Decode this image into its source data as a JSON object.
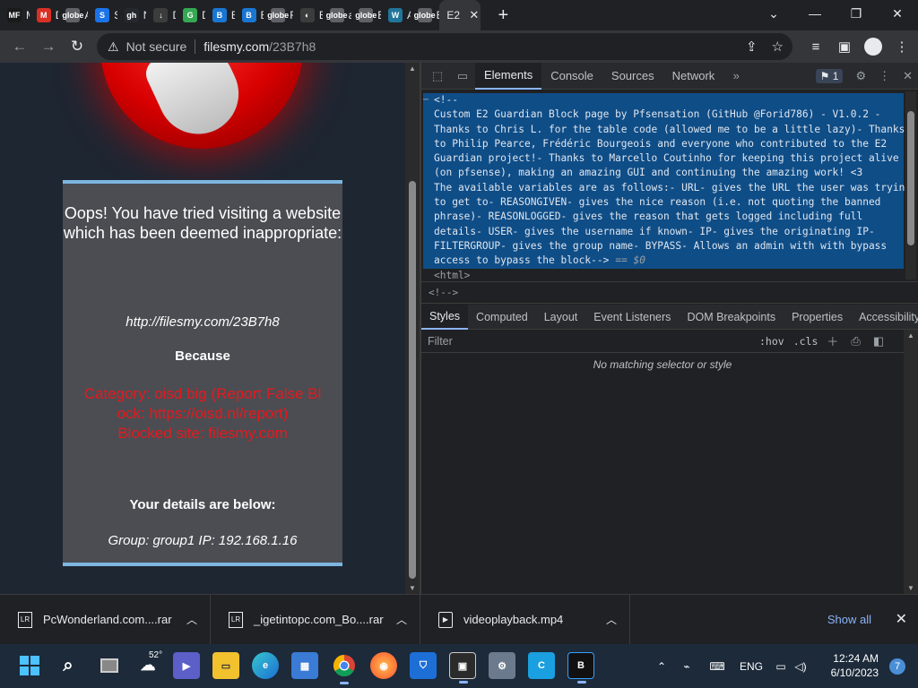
{
  "browser": {
    "tabs": [
      {
        "label": "M",
        "favicon": "MF",
        "color": "#1a1a1a"
      },
      {
        "label": "D",
        "favicon": "M",
        "color": "#d93025"
      },
      {
        "label": "A",
        "favicon": "globe",
        "color": "#5f6368"
      },
      {
        "label": "S",
        "favicon": "S",
        "color": "#1a73e8"
      },
      {
        "label": "N",
        "favicon": "gh",
        "color": "#24292f"
      },
      {
        "label": "D",
        "favicon": "↓",
        "color": "#3c3c3c"
      },
      {
        "label": "D",
        "favicon": "G",
        "color": "#34a853"
      },
      {
        "label": "B",
        "favicon": "B",
        "color": "#1976d2"
      },
      {
        "label": "B",
        "favicon": "B",
        "color": "#1976d2"
      },
      {
        "label": "F",
        "favicon": "globe",
        "color": "#5f6368"
      },
      {
        "label": "B",
        "favicon": "◐",
        "color": "#3c3c3c"
      },
      {
        "label": "a",
        "favicon": "globe",
        "color": "#5f6368"
      },
      {
        "label": "E",
        "favicon": "globe",
        "color": "#5f6368"
      },
      {
        "label": "A",
        "favicon": "W",
        "color": "#21759b"
      },
      {
        "label": "E",
        "favicon": "globe",
        "color": "#5f6368"
      }
    ],
    "active_tab": {
      "label": "E2",
      "close": "✕"
    },
    "new_tab": "+",
    "window_controls": {
      "list": "⌄",
      "minimize": "—",
      "maximize": "❐",
      "close": "✕"
    },
    "toolbar": {
      "back": "←",
      "forward": "→",
      "reload": "↻",
      "security_icon": "⚠",
      "security_text": "Not secure",
      "host": "filesmy.com",
      "path": "/23B7h8",
      "share": "⇪",
      "bookmark": "☆",
      "media": "≡",
      "sidepanel": "▣",
      "profile": "●",
      "menu": "⋮"
    }
  },
  "page": {
    "title": "Oops! You have tried visiting a website which has been deemed inappropriate:",
    "url": "http://filesmy.com/23B7h8",
    "because": "Because",
    "reason_lines": [
      "Category: oisd big (Report False Bl",
      "ock: https://oisd.nl/report)",
      "Blocked site: filesmy.com"
    ],
    "details_heading": "Your details are below:",
    "group_line": "Group: group1   IP: 192.168.1.16"
  },
  "devtools": {
    "tabs": [
      "Elements",
      "Console",
      "Sources",
      "Network"
    ],
    "active_tab": "Elements",
    "more": "»",
    "issues_count": "1",
    "dom_lines": [
      "<!--",
      "Custom E2 Guardian Block page by Pfsensation (GitHub @Forid786) - V1.0.2 -",
      "Thanks to Chris L. for the table code (allowed me to be a little lazy)- Thanks",
      "to Philip Pearce, Frédéric Bourgeois and everyone who contributed to the E2",
      "Guardian project!- Thanks to Marcello Coutinho for keeping this project alive",
      "(on pfsense), making an amazing GUI and continuing the amazing work! <3",
      "The available variables are as follows:- URL- gives the URL the user was trying",
      "to get to- REASONGIVEN- gives the nice reason (i.e. not quoting the banned",
      "phrase)- REASONLOGGED- gives the reason that gets logged including full",
      "details- USER- gives the username if known- IP- gives the originating IP-",
      "FILTERGROUP- gives the group name- BYPASS- Allows an admin with with bypass",
      "access to bypass the block-->"
    ],
    "selected_marker": "== $0",
    "html_tag": "<html>",
    "breadcrumb": "<!--> ",
    "styles_tabs": [
      "Styles",
      "Computed",
      "Layout",
      "Event Listeners",
      "DOM Breakpoints",
      "Properties",
      "Accessibility"
    ],
    "active_styles_tab": "Styles",
    "filter_placeholder": "Filter",
    "hov": ":hov",
    "cls": ".cls",
    "no_match": "No matching selector or style"
  },
  "downloads": {
    "items": [
      {
        "name": "PcWonderland.com....rar",
        "icon": "rar"
      },
      {
        "name": "_igetintopc.com_Bo....rar",
        "icon": "rar"
      },
      {
        "name": "videoplayback.mp4",
        "icon": "mp4"
      }
    ],
    "show_all": "Show all",
    "close": "✕"
  },
  "taskbar": {
    "weather_temp": "52°",
    "tray": {
      "chevron": "⌃",
      "lang": "ENG"
    },
    "time": "12:24 AM",
    "date": "6/10/2023",
    "notifications": "7"
  }
}
